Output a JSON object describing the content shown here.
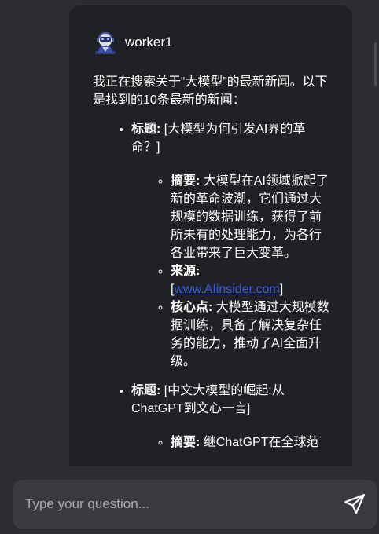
{
  "message": {
    "author": "worker1",
    "intro": "我正在搜索关于“大模型”的最新新闻。以下是找到的10条最新的新闻：",
    "news": [
      {
        "title_label": "标题:",
        "title_value": "[大模型为何引发AI界的革命？]",
        "summary_label": "摘要:",
        "summary_value": "大模型在AI领域掀起了新的革命波潮，它们通过大规模的数据训练，获得了前所未有的处理能力，为各行各业带来了巨大变革。",
        "source_label": "来源:",
        "source_open": "[",
        "source_link": "www.AIinsider.com",
        "source_close": "]",
        "point_label": "核心点:",
        "point_value": "大模型通过大规模数据训练，具备了解决复杂任务的能力，推动了AI全面升级。"
      },
      {
        "title_label": "标题:",
        "title_value": "[中文大模型的崛起:从ChatGPT到文心一言]",
        "summary_label": "摘要:",
        "summary_value": "继ChatGPT在全球范"
      }
    ]
  },
  "input": {
    "placeholder": "Type your question..."
  },
  "icons": {
    "avatar": "robot-avatar-icon",
    "send": "send-icon"
  }
}
